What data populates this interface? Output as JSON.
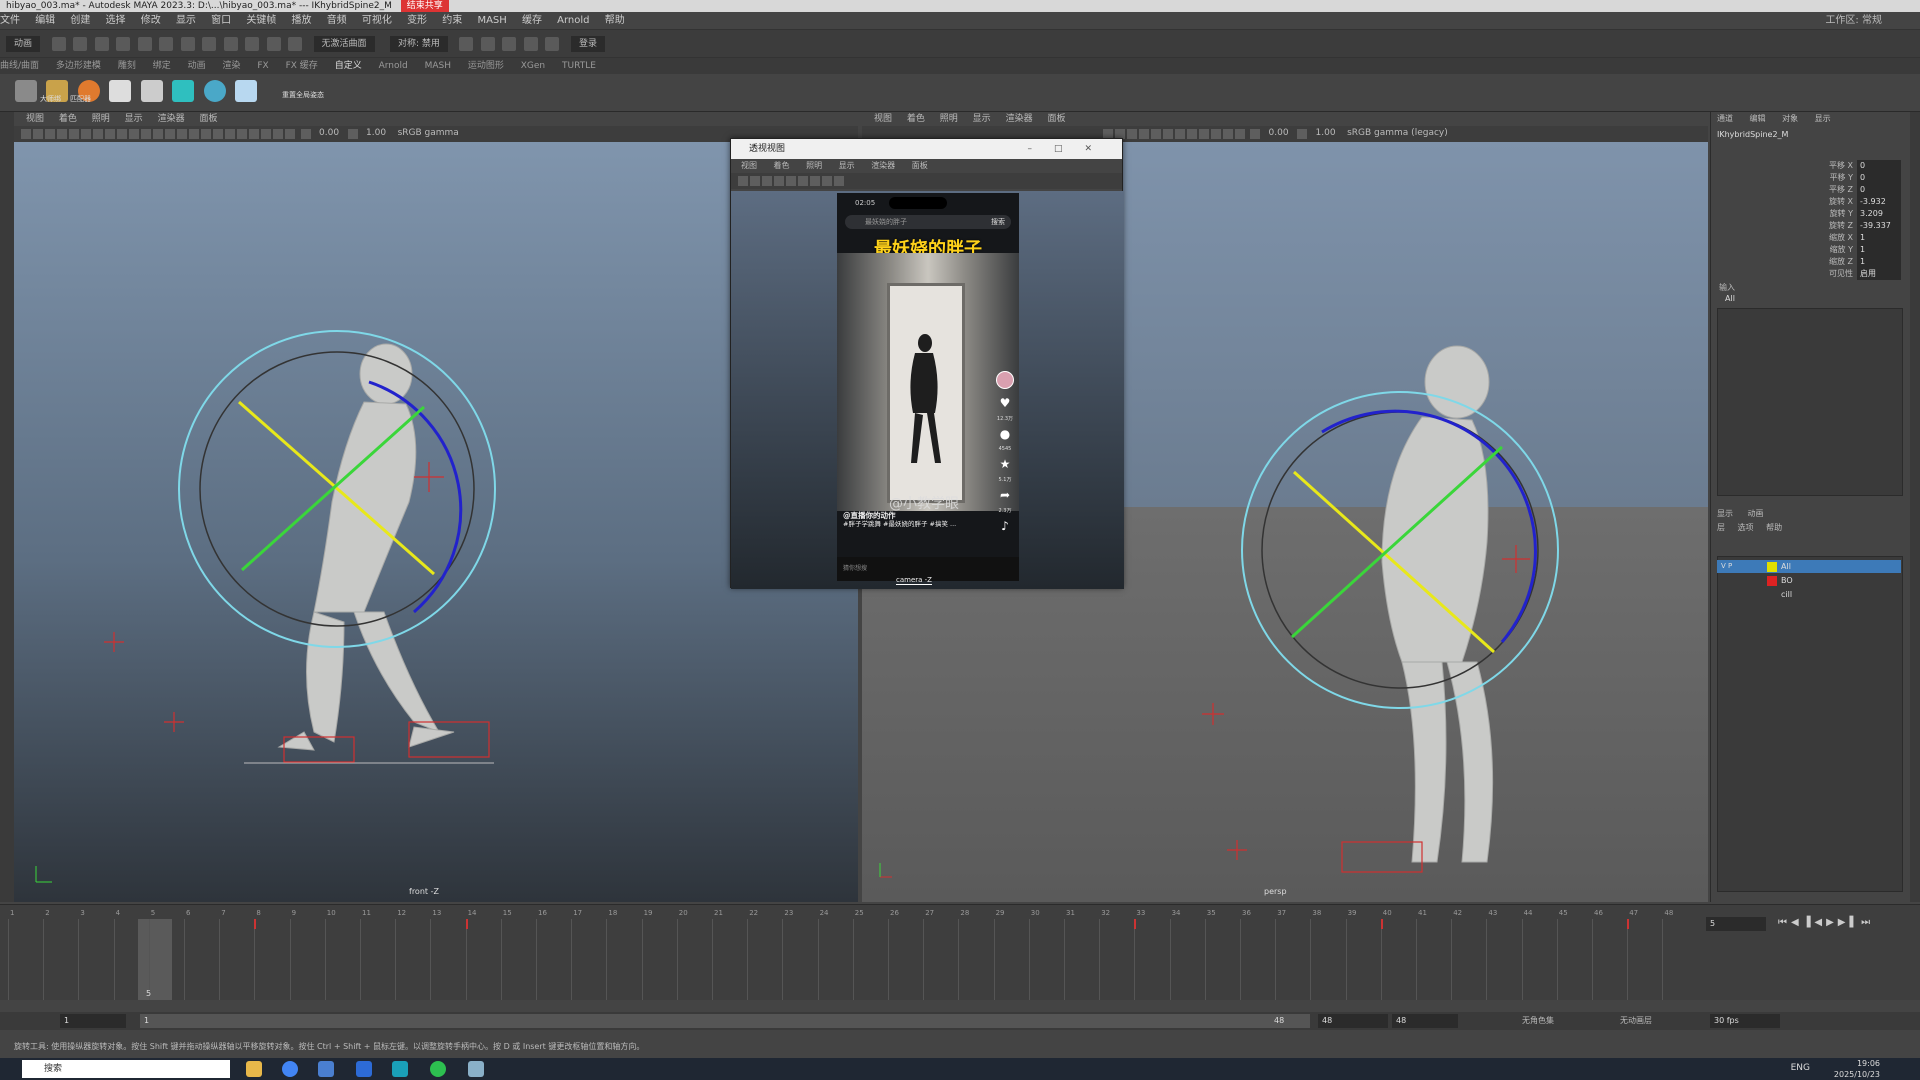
{
  "titlebar": {
    "text": "hibyao_003.ma* - Autodesk MAYA 2023.3: D:\\...\\hibyao_003.ma* --- IKhybridSpine2_M",
    "recording_label": "结束共享"
  },
  "menubar": {
    "items": [
      "文件",
      "编辑",
      "创建",
      "选择",
      "修改",
      "显示",
      "窗口",
      "关键帧",
      "播放",
      "音频",
      "可视化",
      "变形",
      "约束",
      "MASH",
      "缓存",
      "Arnold",
      "帮助"
    ],
    "workspace_label": "工作区: 常规"
  },
  "statusline": {
    "mode_dropdown": "动画",
    "live_surface": "无激活曲面",
    "symmetry": "对称: 禁用",
    "login": "登录"
  },
  "shelf": {
    "tabs": [
      "曲线/曲面",
      "多边形建模",
      "雕刻",
      "绑定",
      "动画",
      "渲染",
      "FX",
      "FX 缓存",
      "自定义",
      "Arnold",
      "MASH",
      "运动图形",
      "XGen",
      "TURTLE"
    ],
    "active_tab": "自定义",
    "button_label_1": "大师绑",
    "button_label_2": "匹配器",
    "button_label_3": "重置全局姿态"
  },
  "viewport_left": {
    "menus": [
      "视图",
      "着色",
      "照明",
      "显示",
      "渲染器",
      "面板"
    ],
    "num1": "0.00",
    "num2": "1.00",
    "colorspace": "sRGB gamma",
    "label": "front -Z"
  },
  "viewport_right": {
    "menus": [
      "视图",
      "着色",
      "照明",
      "显示",
      "渲染器",
      "面板"
    ],
    "num1": "0.00",
    "num2": "1.00",
    "colorspace": "sRGB gamma (legacy)",
    "label": "persp"
  },
  "float_window": {
    "title": "透视视图",
    "menus": [
      "视图",
      "着色",
      "照明",
      "显示",
      "渲染器",
      "面板"
    ],
    "label": "camera -Z",
    "phone": {
      "time": "02:05",
      "search_text": "最妖娆的胖子",
      "search_button": "搜索",
      "title": "最妖娆的胖子",
      "watermark": "@小教学眼",
      "author": "@直播你的动作",
      "caption": "#胖子学跳舞 #最妖娆的胖子 #搞笑 ...",
      "bottom_text": "猜你想搜",
      "side_counts": [
        "12.3万",
        "4545",
        "5.1万",
        "2.3万"
      ]
    }
  },
  "channel_box": {
    "tabs": [
      "通道",
      "编辑",
      "对象",
      "显示"
    ],
    "node": "IKhybridSpine2_M",
    "attrs": [
      {
        "label": "平移 X",
        "value": "0"
      },
      {
        "label": "平移 Y",
        "value": "0"
      },
      {
        "label": "平移 Z",
        "value": "0"
      },
      {
        "label": "旋转 X",
        "value": "-3.932"
      },
      {
        "label": "旋转 Y",
        "value": "3.209"
      },
      {
        "label": "旋转 Z",
        "value": "-39.337"
      },
      {
        "label": "缩放 X",
        "value": "1"
      },
      {
        "label": "缩放 Y",
        "value": "1"
      },
      {
        "label": "缩放 Z",
        "value": "1"
      },
      {
        "label": "可见性",
        "value": "启用"
      }
    ],
    "input_label": "输入",
    "input_all": "All"
  },
  "layer_editor": {
    "tabs": [
      "显示",
      "动画"
    ],
    "menus": [
      "层",
      "选项",
      "帮助"
    ],
    "layers": [
      {
        "name": "All",
        "color": "#e0e000",
        "vp": "V P"
      },
      {
        "name": "BO",
        "color": "#dd2222",
        "vp": ""
      },
      {
        "name": "cill",
        "color": "",
        "vp": ""
      }
    ]
  },
  "timeline": {
    "ticks": [
      "1",
      "2",
      "3",
      "4",
      "5",
      "6",
      "7",
      "8",
      "9",
      "10",
      "11",
      "12",
      "13",
      "14",
      "15",
      "16",
      "17",
      "18",
      "19",
      "20",
      "21",
      "22",
      "23",
      "24",
      "25",
      "26",
      "27",
      "28",
      "29",
      "30",
      "31",
      "32",
      "33",
      "34",
      "35",
      "36",
      "37",
      "38",
      "39",
      "40",
      "41",
      "42",
      "43",
      "44",
      "45",
      "46",
      "47",
      "48"
    ],
    "current_frame": "5",
    "current_frame_box": "5"
  },
  "range": {
    "start": "1",
    "inner_start": "1",
    "inner_end": "48",
    "end_a": "48",
    "end_b": "48",
    "char_set": "无角色集",
    "anim_layer": "无动画层",
    "fps": "30 fps"
  },
  "helpline": {
    "text": "旋转工具: 使用操纵器旋转对象。按住 Shift 键并拖动操纵器轴以平移旋转对象。按住 Ctrl + Shift + 鼠标左键。以调整旋转手柄中心。按 D 或 Insert 键更改枢轴位置和轴方向。"
  },
  "taskbar": {
    "search": "搜索",
    "lang": "ENG",
    "time": "19:06",
    "date": "2025/10/23"
  },
  "colors": {
    "ring_outer": "#7fd8e8",
    "ring_blue": "#2222cc",
    "ring_yellow": "#e8e81a",
    "ring_green": "#3ad63a",
    "accent_layer": "#3d7ab8"
  }
}
